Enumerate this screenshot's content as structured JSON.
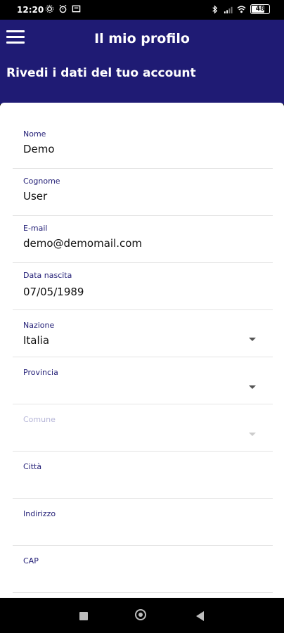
{
  "status_bar": {
    "time": "12:20",
    "battery": "48"
  },
  "header": {
    "title": "Il mio profilo",
    "subtitle": "Rivedi i dati del tuo account"
  },
  "fields": [
    {
      "label": "Nome",
      "value": "Demo",
      "dropdown": false,
      "disabled": false
    },
    {
      "label": "Cognome",
      "value": "User",
      "dropdown": false,
      "disabled": false
    },
    {
      "label": "E-mail",
      "value": "demo@demomail.com",
      "dropdown": false,
      "disabled": false
    },
    {
      "label": "Data nascita",
      "value": "07/05/1989",
      "dropdown": false,
      "disabled": false
    },
    {
      "label": "Nazione",
      "value": "Italia",
      "dropdown": true,
      "disabled": false
    },
    {
      "label": "Provincia",
      "value": "",
      "dropdown": true,
      "disabled": false
    },
    {
      "label": "Comune",
      "value": "",
      "dropdown": true,
      "disabled": true
    },
    {
      "label": "Città",
      "value": "",
      "dropdown": false,
      "disabled": false
    },
    {
      "label": "Indirizzo",
      "value": "",
      "dropdown": false,
      "disabled": false
    },
    {
      "label": "CAP",
      "value": "",
      "dropdown": false,
      "disabled": false
    }
  ],
  "colors": {
    "primary": "#1f1b74",
    "label": "#1f1b74",
    "disabled_label": "#b6b6d8",
    "background": "#ffffff"
  },
  "icons": {
    "menu": "hamburger-menu-icon",
    "dropdown": "chevron-down-icon",
    "nav_recents": "square-icon",
    "nav_home": "circle-icon",
    "nav_back": "triangle-back-icon"
  }
}
